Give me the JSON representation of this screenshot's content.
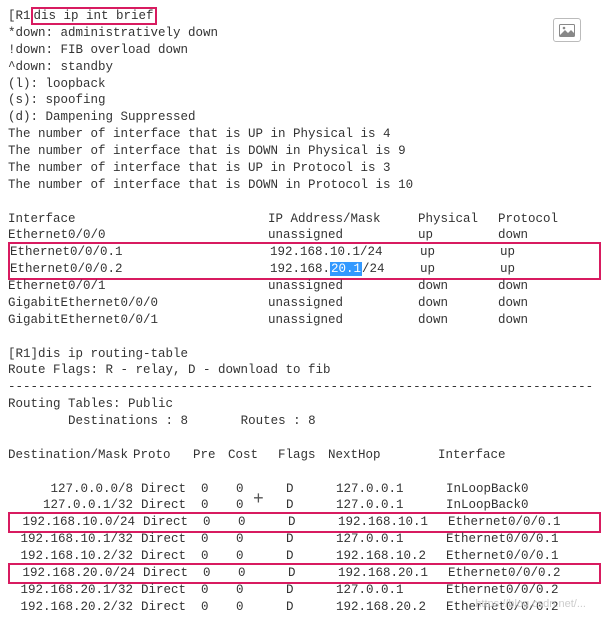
{
  "prompt": "[R1",
  "command": "dis ip int brief",
  "legend": [
    "*down: administratively down",
    "!down: FIB overload down",
    "^down: standby",
    "(l): loopback",
    "(s): spoofing",
    "(d): Dampening Suppressed"
  ],
  "summary": [
    "The number of interface that is UP in Physical is 4",
    "The number of interface that is DOWN in Physical is 9",
    "The number of interface that is UP in Protocol is 3",
    "The number of interface that is DOWN in Protocol is 10"
  ],
  "ifHeader": {
    "if": "Interface",
    "ip": "IP Address/Mask",
    "phy": "Physical",
    "pro": "Protocol"
  },
  "ifRows": [
    {
      "if": "Ethernet0/0/0",
      "ip": "unassigned",
      "phy": "up",
      "pro": "down",
      "hl": false
    },
    {
      "if": "Ethernet0/0/0.1",
      "ip": "192.168.10.1/24",
      "phy": "up",
      "pro": "up",
      "hl": true
    },
    {
      "if": "Ethernet0/0/0.2",
      "ip_pre": "192.168.",
      "ip_sel": "20.1",
      "ip_post": "/24",
      "phy": "up",
      "pro": "up",
      "hl": true
    },
    {
      "if": "Ethernet0/0/1",
      "ip": "unassigned",
      "phy": "down",
      "pro": "down",
      "hl": false
    },
    {
      "if": "GigabitEthernet0/0/0",
      "ip": "unassigned",
      "phy": "down",
      "pro": "down",
      "hl": false
    },
    {
      "if": "GigabitEthernet0/0/1",
      "ip": "unassigned",
      "phy": "down",
      "pro": "down",
      "hl": false
    }
  ],
  "rtPrompt": "[R1]",
  "rtCommand": "dis ip routing-table",
  "rtFlags": "Route Flags: R - relay, D - download to fib",
  "rtPublic": "Routing Tables: Public",
  "rtDest": "Destinations : 8",
  "rtRoutes": "Routes : 8",
  "rtHeader": {
    "dest": "Destination/Mask",
    "proto": "Proto",
    "pre": "Pre",
    "cost": "Cost",
    "flags": "Flags",
    "nh": "NextHop",
    "if": "Interface"
  },
  "rtRows": [
    {
      "dest": "127.0.0.0/8",
      "proto": "Direct",
      "pre": "0",
      "cost": "0",
      "flags": "D",
      "nh": "127.0.0.1",
      "if": "InLoopBack0",
      "hl": false
    },
    {
      "dest": "127.0.0.1/32",
      "proto": "Direct",
      "pre": "0",
      "cost": "0",
      "flags": "D",
      "nh": "127.0.0.1",
      "if": "InLoopBack0",
      "hl": false
    },
    {
      "dest": "192.168.10.0/24",
      "proto": "Direct",
      "pre": "0",
      "cost": "0",
      "flags": "D",
      "nh": "192.168.10.1",
      "if": "Ethernet0/0/0.1",
      "hl": true
    },
    {
      "dest": "192.168.10.1/32",
      "proto": "Direct",
      "pre": "0",
      "cost": "0",
      "flags": "D",
      "nh": "127.0.0.1",
      "if": "Ethernet0/0/0.1",
      "hl": false
    },
    {
      "dest": "192.168.10.2/32",
      "proto": "Direct",
      "pre": "0",
      "cost": "0",
      "flags": "D",
      "nh": "192.168.10.2",
      "if": "Ethernet0/0/0.1",
      "hl": false
    },
    {
      "dest": "192.168.20.0/24",
      "proto": "Direct",
      "pre": "0",
      "cost": "0",
      "flags": "D",
      "nh": "192.168.20.1",
      "if": "Ethernet0/0/0.2",
      "hl": true
    },
    {
      "dest": "192.168.20.1/32",
      "proto": "Direct",
      "pre": "0",
      "cost": "0",
      "flags": "D",
      "nh": "127.0.0.1",
      "if": "Ethernet0/0/0.2",
      "hl": false
    },
    {
      "dest": "192.168.20.2/32",
      "proto": "Direct",
      "pre": "0",
      "cost": "0",
      "flags": "D",
      "nh": "192.168.20.2",
      "if": "Ethernet0/0/0.2",
      "hl": false
    }
  ],
  "plusX": 245,
  "plusY": 492
}
